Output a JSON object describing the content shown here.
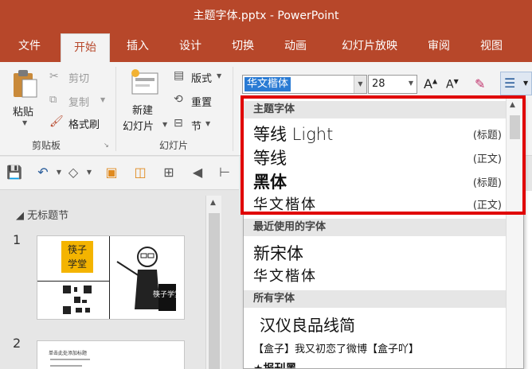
{
  "window": {
    "title": "主题字体.pptx  -  PowerPoint"
  },
  "tabs": [
    "文件",
    "开始",
    "插入",
    "设计",
    "切换",
    "动画",
    "幻灯片放映",
    "审阅",
    "视图"
  ],
  "ribbon": {
    "paste": "粘贴",
    "cut": "剪切",
    "copy": "复制",
    "format_painter": "格式刷",
    "clipboard_group": "剪贴板",
    "new_slide_line1": "新建",
    "new_slide_line2": "幻灯片",
    "layout": "版式",
    "reset": "重置",
    "section": "节",
    "slides_group": "幻灯片",
    "font_name": "华文楷体",
    "font_size": "28"
  },
  "slides_pane": {
    "section_title": "无标题节",
    "slide1_number": "1",
    "slide1_badge": "筷子\n学堂",
    "slide1_board": "筷子学堂",
    "slide2_number": "2",
    "slide2_heading": "单击此处添加标题"
  },
  "font_dropdown": {
    "theme_header": "主题字体",
    "theme_fonts": [
      {
        "name": "等线 Light",
        "tag": "(标题)"
      },
      {
        "name": "等线",
        "tag": "(正文)"
      },
      {
        "name": "黑体",
        "tag": "(标题)"
      },
      {
        "name": "华文楷体",
        "tag": "(正文)"
      }
    ],
    "recent_header": "最近使用的字体",
    "recent_fonts": [
      "新宋体",
      "华文楷体"
    ],
    "all_header": "所有字体",
    "all_fonts": [
      "汉仪良品线简",
      "【盒子】我又初恋了微博【盒子吖】",
      "★报刊黑"
    ]
  },
  "colors": {
    "accent": "#b7472a",
    "highlight": "#e00000"
  }
}
